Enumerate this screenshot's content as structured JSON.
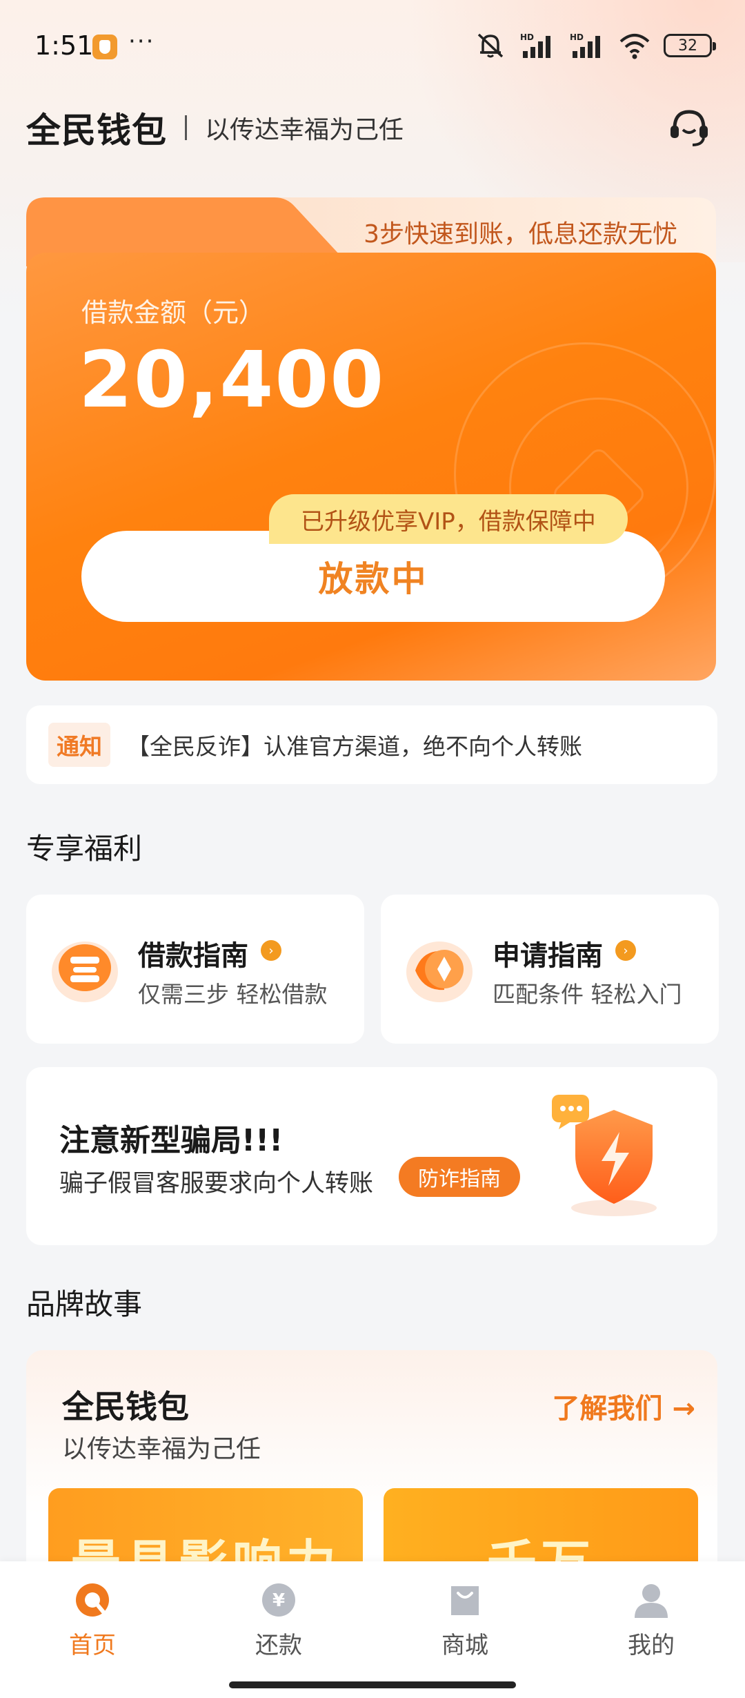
{
  "status_bar": {
    "time": "1:51",
    "dots": "···",
    "battery": "32"
  },
  "header": {
    "brand": "全民钱包",
    "slogan": "以传达幸福为己任"
  },
  "hero": {
    "badge": "3步快速到账，低息还款无忧",
    "amount_label": "借款金额（元）",
    "amount": "20,400",
    "vip_tag": "已升级优享VIP，借款保障中",
    "button_label": "放款中"
  },
  "notice": {
    "tag": "通知",
    "text": "【全民反诈】认准官方渠道，绝不向个人转账"
  },
  "welfare": {
    "section_title": "专享福利",
    "cards": [
      {
        "title": "借款指南",
        "subtitle": "仅需三步 轻松借款"
      },
      {
        "title": "申请指南",
        "subtitle": "匹配条件 轻松入门"
      }
    ]
  },
  "fraud": {
    "title": "注意新型骗局!!!",
    "desc": "骗子假冒客服要求向个人转账",
    "button": "防诈指南"
  },
  "brand_story": {
    "section_title": "品牌故事",
    "title": "全民钱包",
    "subtitle": "以传达幸福为己任",
    "link": "了解我们 →",
    "tiles": [
      "最具影响力",
      "千万"
    ]
  },
  "nav": {
    "items": [
      {
        "label": "首页",
        "icon": "home-icon"
      },
      {
        "label": "还款",
        "icon": "repay-icon"
      },
      {
        "label": "商城",
        "icon": "mall-icon"
      },
      {
        "label": "我的",
        "icon": "profile-icon"
      }
    ],
    "active_color": "#f0791e"
  },
  "colors": {
    "accent": "#f47b22",
    "hero_start": "#ff9a3c",
    "hero_end": "#ff7a0e"
  }
}
